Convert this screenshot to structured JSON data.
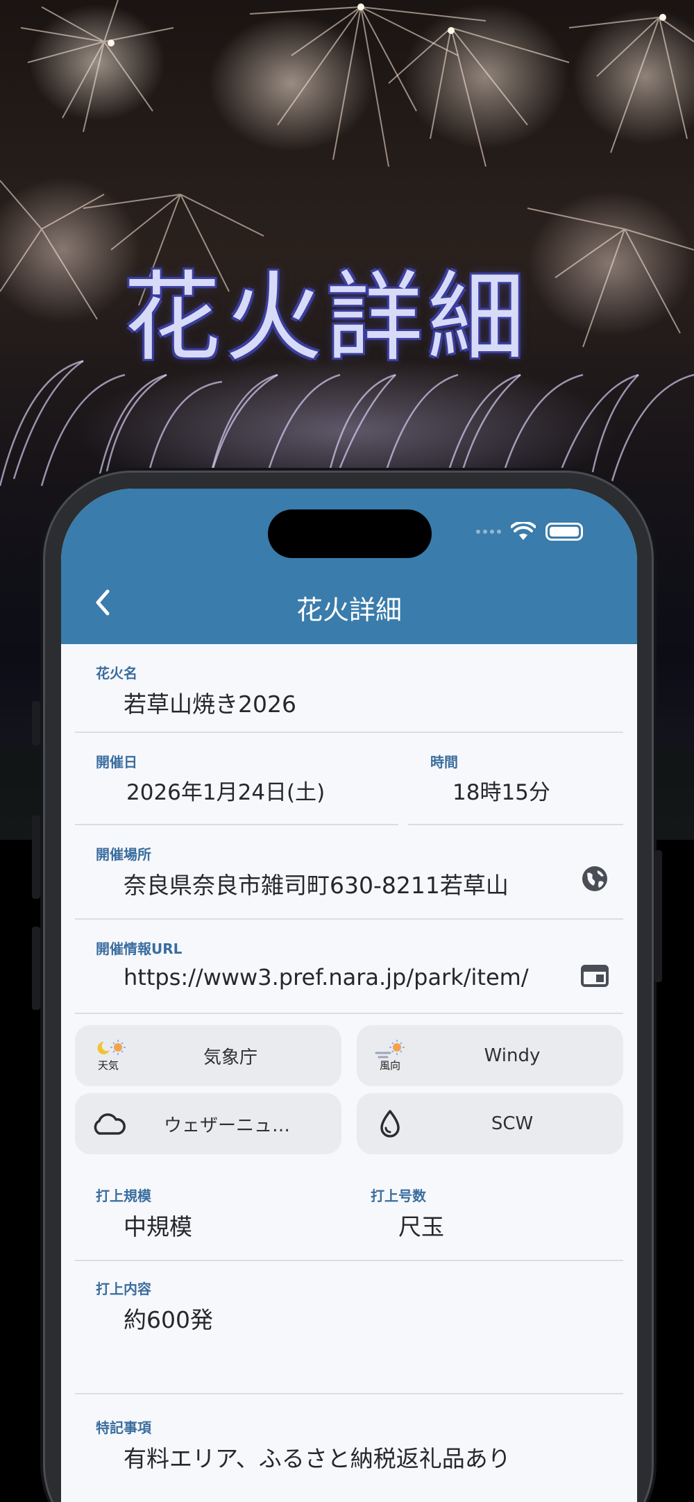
{
  "hero": {
    "title": "花火詳細"
  },
  "status_bar": {
    "icons": [
      "signal-dots-icon",
      "wifi-icon",
      "battery-icon"
    ]
  },
  "appbar": {
    "title": "花火詳細",
    "back_icon": "chevron-left-icon"
  },
  "fields": {
    "name": {
      "label": "花火名",
      "value": "若草山焼き2026"
    },
    "date": {
      "label": "開催日",
      "value": "2026年1月24日(土)"
    },
    "time": {
      "label": "時間",
      "value": "18時15分"
    },
    "place": {
      "label": "開催場所",
      "value": "奈良県奈良市雑司町630-8211若草山",
      "icon": "globe-icon"
    },
    "url": {
      "label": "開催情報URL",
      "value": "https://www3.pref.nara.jp/park/item/",
      "icon": "web-window-icon"
    },
    "scale": {
      "label": "打上規模",
      "value": "中規模"
    },
    "size": {
      "label": "打上号数",
      "value": "尺玉"
    },
    "content": {
      "label": "打上内容",
      "value": "約600発"
    },
    "notes": {
      "label": "特記事項",
      "value": "有料エリア、ふるさと納税返礼品あり"
    }
  },
  "weather_links": [
    {
      "label": "気象庁",
      "icon": "weather-icon",
      "icon_text": "天気"
    },
    {
      "label": "Windy",
      "icon": "wind-direction-icon",
      "icon_text": "風向"
    },
    {
      "label": "ウェザーニュ…",
      "icon": "cloud-icon"
    },
    {
      "label": "SCW",
      "icon": "water-drop-icon"
    }
  ],
  "colors": {
    "appbar": "#3a7cab",
    "label": "#3a6d9e",
    "chip_bg": "#e9ebef",
    "screen_bg": "#f7f8fc",
    "hero_title_fill": "#d7dbf8",
    "hero_title_outline": "#3b3e9c"
  }
}
